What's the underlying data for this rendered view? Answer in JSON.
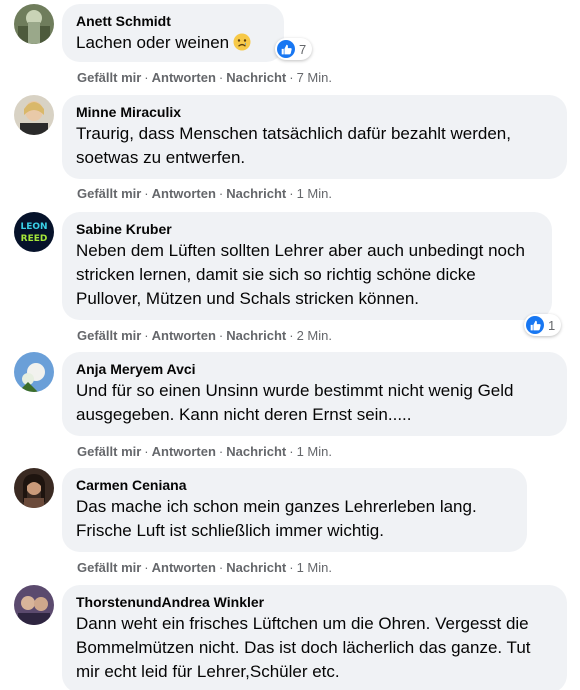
{
  "comments": [
    {
      "author": "Anett Schmidt",
      "text": "Lachen oder weinen",
      "emoji": "sad-face-emoji",
      "reaction_count": "7",
      "actions": {
        "like": "Gefällt mir",
        "reply": "Antworten",
        "message": "Nachricht",
        "time": "7 Min."
      }
    },
    {
      "author": "Minne Miraculix",
      "text": "Traurig, dass Menschen tatsächlich dafür bezahlt werden, soetwas zu entwerfen.",
      "actions": {
        "like": "Gefällt mir",
        "reply": "Antworten",
        "message": "Nachricht",
        "time": "1 Min."
      }
    },
    {
      "author": "Sabine Kruber",
      "text": "Neben dem Lüften sollten Lehrer aber auch unbedingt noch stricken lernen, damit sie sich so richtig schöne dicke Pullover, Mützen und Schals stricken können.",
      "reaction_count": "1",
      "avatar_text": "LEON REED",
      "actions": {
        "like": "Gefällt mir",
        "reply": "Antworten",
        "message": "Nachricht",
        "time": "2 Min."
      }
    },
    {
      "author": "Anja Meryem Avci",
      "text": "Und für so einen Unsinn wurde bestimmt nicht wenig Geld ausgegeben. Kann nicht deren Ernst sein.....",
      "actions": {
        "like": "Gefällt mir",
        "reply": "Antworten",
        "message": "Nachricht",
        "time": "1 Min."
      }
    },
    {
      "author": "Carmen Ceniana",
      "text": "Das mache ich schon mein ganzes Lehrerleben lang. Frische Luft ist schließlich immer wichtig.",
      "actions": {
        "like": "Gefällt mir",
        "reply": "Antworten",
        "message": "Nachricht",
        "time": "1 Min."
      }
    },
    {
      "author": "ThorstenundAndrea Winkler",
      "text": "Dann weht ein frisches Lüftchen um die Ohren. Vergesst die Bommelmützen nicht. Das ist doch lächerlich das ganze. Tut mir echt leid für Lehrer,Schüler etc."
    }
  ],
  "colors": {
    "bubble": "#f0f2f5",
    "meta": "#65676b",
    "like_blue": "#1877f2"
  }
}
